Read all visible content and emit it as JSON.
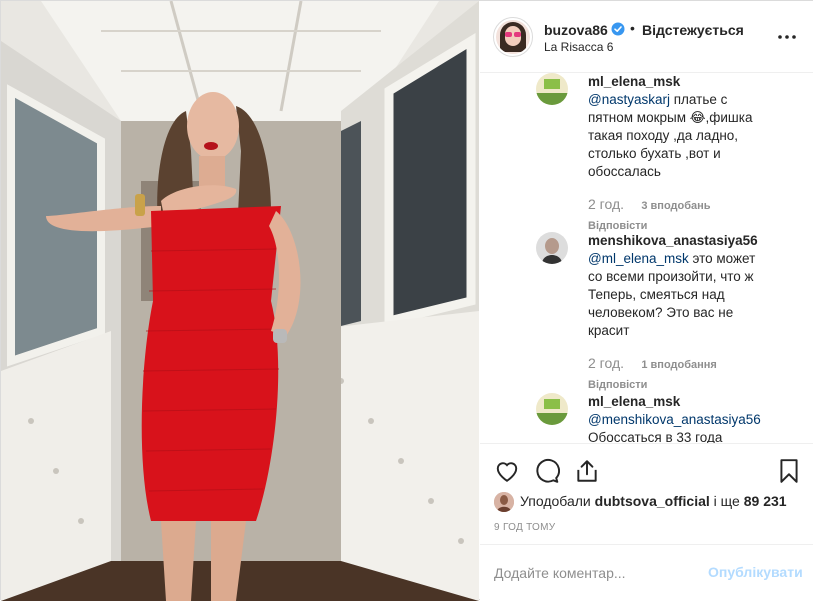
{
  "header": {
    "username": "buzova86",
    "separator": "•",
    "follow_state": "Відстежується",
    "location": "La Risacca 6",
    "icons": {
      "avatar": "profile-avatar",
      "verified": "verified-badge-icon",
      "more": "more-options-icon"
    }
  },
  "comments": [
    {
      "username": "ml_elena_msk",
      "mention": "@nastyaskarj",
      "text": " платье с пятном мокрым 😂,фишка такая походу ,да ладно, столько бухать ,вот и обоссалась",
      "time": "2 год.",
      "likes": "3 вподобань",
      "reply": "Відповісти"
    },
    {
      "username": "menshikova_anastasiya56",
      "mention": "@ml_elena_msk",
      "text": " это может со всеми произойти, что ж Теперь, смеяться над человеком? Это вас не красит",
      "time": "2 год.",
      "likes": "1 вподобання",
      "reply": "Відповісти"
    },
    {
      "username": "ml_elena_msk",
      "mention": "@menshikova_anastasiya56",
      "text": " Обоссаться в 33 года",
      "time": "",
      "likes": "",
      "reply": ""
    }
  ],
  "actions": {
    "icons": [
      "heart-icon",
      "comment-icon",
      "share-icon",
      "bookmark-icon"
    ]
  },
  "likes_line": {
    "prefix": "Уподобали ",
    "user": "dubtsova_official",
    "middle": " і ще ",
    "count": "89 231"
  },
  "timestamp": "9 ГОД ТОМУ",
  "add_comment": {
    "placeholder": "Додайте коментар...",
    "post_label": "Опублікувати"
  },
  "colors": {
    "link": "#00376b",
    "verified": "#3897f0",
    "post_disabled": "#b3dbff",
    "muted": "#8e8e8e",
    "dress": "#d8121b"
  }
}
